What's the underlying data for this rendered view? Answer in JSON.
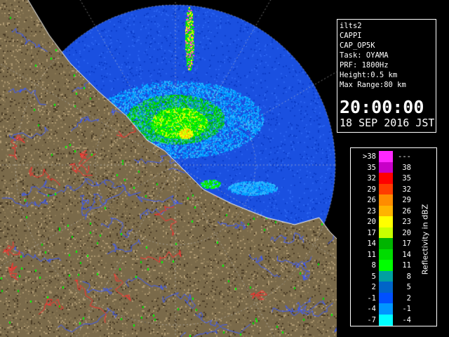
{
  "info_panel": {
    "lines": [
      "ilts2",
      "CAPPI",
      "CAP_OP5K",
      "Task: OYAMA",
      "PRF: 1800Hz",
      "Height:0.5 km",
      "Max Range:80 km"
    ],
    "time": "20:00:00",
    "date": "18 SEP 2016 JST"
  },
  "legend": {
    "unit_label": "Reflectivity in dBZ",
    "bins": [
      {
        "lo": ">38",
        "hi": "---",
        "color": "#ff28ff"
      },
      {
        "lo": "35",
        "hi": "38",
        "color": "#c800c8"
      },
      {
        "lo": "32",
        "hi": "35",
        "color": "#ff0000"
      },
      {
        "lo": "29",
        "hi": "32",
        "color": "#ff3c00"
      },
      {
        "lo": "26",
        "hi": "29",
        "color": "#ff8c00"
      },
      {
        "lo": "23",
        "hi": "26",
        "color": "#ffb400"
      },
      {
        "lo": "20",
        "hi": "23",
        "color": "#ffff00"
      },
      {
        "lo": "17",
        "hi": "20",
        "color": "#c8ff00"
      },
      {
        "lo": "14",
        "hi": "17",
        "color": "#00b400"
      },
      {
        "lo": "11",
        "hi": "14",
        "color": "#00dc00"
      },
      {
        "lo": "8",
        "hi": "11",
        "color": "#00ff00"
      },
      {
        "lo": "5",
        "hi": "8",
        "color": "#00a0a0"
      },
      {
        "lo": "2",
        "hi": "5",
        "color": "#0064c8"
      },
      {
        "lo": "-1",
        "hi": "2",
        "color": "#0050ff"
      },
      {
        "lo": "-4",
        "hi": "-1",
        "color": "#0096ff"
      },
      {
        "lo": "-7",
        "hi": "-4",
        "color": "#00ffff"
      }
    ]
  },
  "map": {
    "land_color": "#7a6a4a",
    "land_dark_color": "#4a3c26",
    "land_light_color": "#b09a72",
    "sea_color": "#000000",
    "echo_background_color": "#1a50e0",
    "river_color": "#3a5aff",
    "border_color": "#ff3030"
  }
}
